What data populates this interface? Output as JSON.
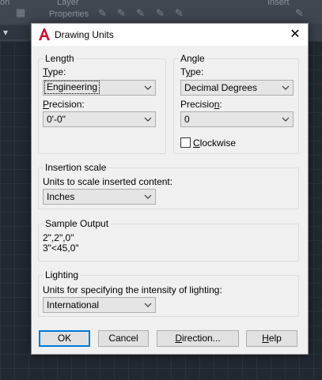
{
  "background": {
    "ribbon_fragment_left": "on",
    "ribbon_layer_label": "Layer",
    "ribbon_properties_label": "Properties",
    "ribbon_insert_label": "Insert",
    "dropdown_arrow": "▾"
  },
  "dialog": {
    "title": "Drawing Units",
    "close_glyph": "✕",
    "length": {
      "legend": "Length",
      "type_label": "Type:",
      "type_value": "Engineering",
      "precision_label": "Precision:",
      "precision_value": "0'-0\""
    },
    "angle": {
      "legend": "Angle",
      "type_label": "Type:",
      "type_value": "Decimal Degrees",
      "precision_label": "Precision:",
      "precision_value": "0",
      "clockwise_label": "Clockwise",
      "clockwise_checked": false
    },
    "insertion": {
      "legend": "Insertion scale",
      "units_label": "Units to scale inserted content:",
      "units_value": "Inches"
    },
    "sample": {
      "legend": "Sample Output",
      "line1": "2\",2\",0\"",
      "line2": "3\"<45,0\""
    },
    "lighting": {
      "legend": "Lighting",
      "units_label": "Units for specifying the intensity of lighting:",
      "units_value": "International"
    },
    "buttons": {
      "ok": "OK",
      "cancel": "Cancel",
      "direction": "Direction...",
      "help": "Help"
    }
  },
  "colors": {
    "app_icon_red": "#c8102e",
    "default_button_border": "#0078d7",
    "canvas_bg": "#212830"
  }
}
